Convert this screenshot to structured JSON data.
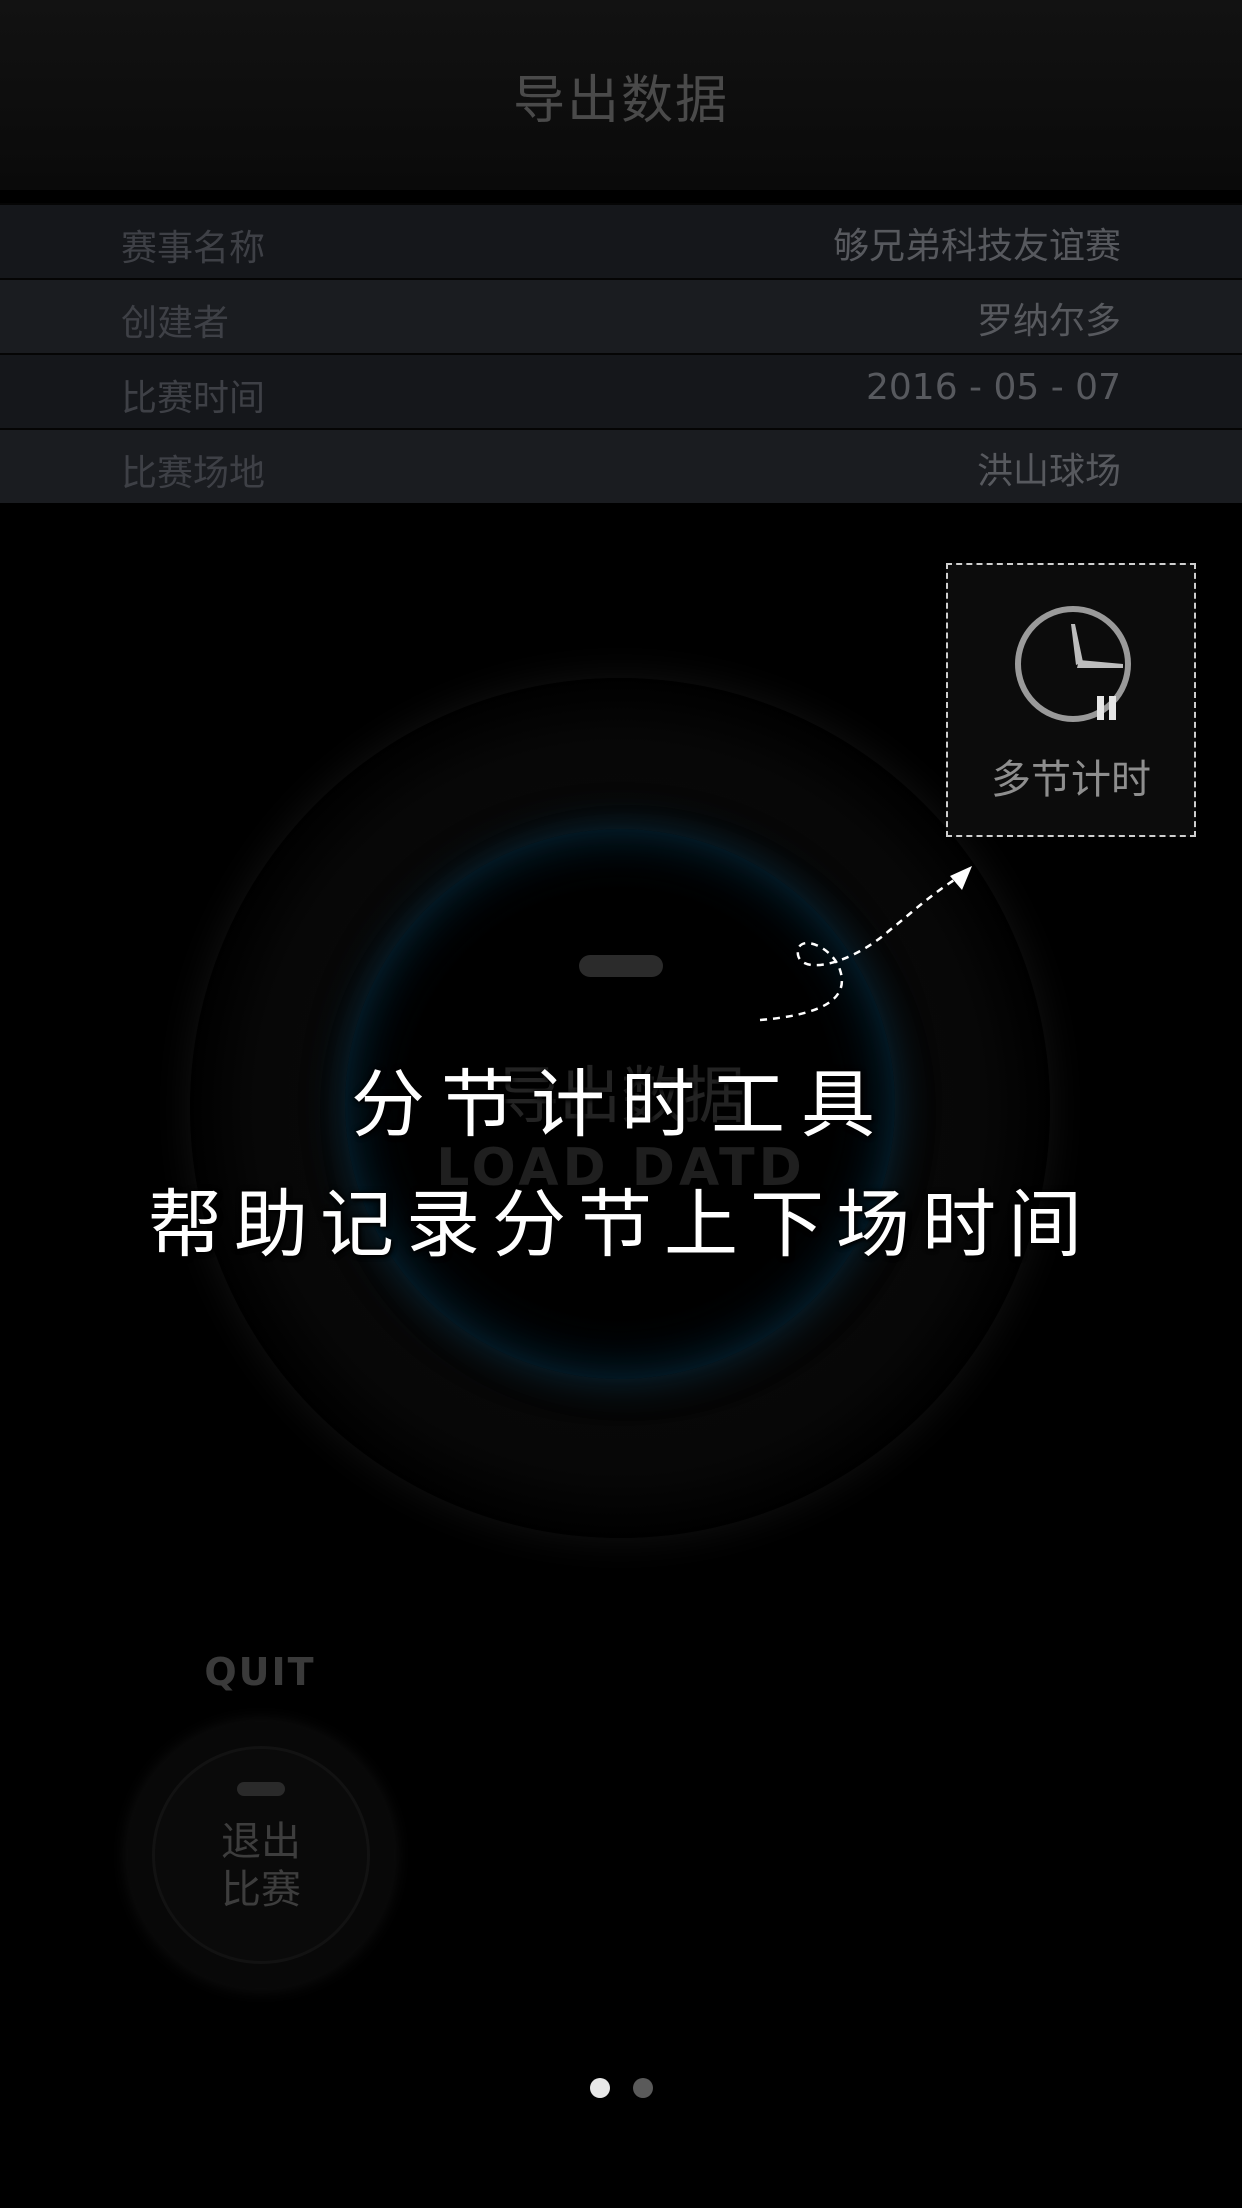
{
  "header": {
    "title": "导出数据"
  },
  "info": [
    {
      "key": "赛事名称",
      "value": "够兄弟科技友谊赛"
    },
    {
      "key": "创建者",
      "value": "罗纳尔多"
    },
    {
      "key": "比赛时间",
      "value": "2016 - 05 - 07"
    },
    {
      "key": "比赛场地",
      "value": "洪山球场"
    }
  ],
  "main_button": {
    "label": "导出数据",
    "sublabel": "LOAD DATD"
  },
  "multi_timer": {
    "label": "多节计时",
    "icon": "clock-pause-icon"
  },
  "hint": {
    "line1": "分节计时工具",
    "line2": "帮助记录分节上下场时间"
  },
  "quit": {
    "title": "QUIT",
    "label_line1": "退出",
    "label_line2": "比赛"
  },
  "pager": {
    "total": 2,
    "active": 1
  }
}
